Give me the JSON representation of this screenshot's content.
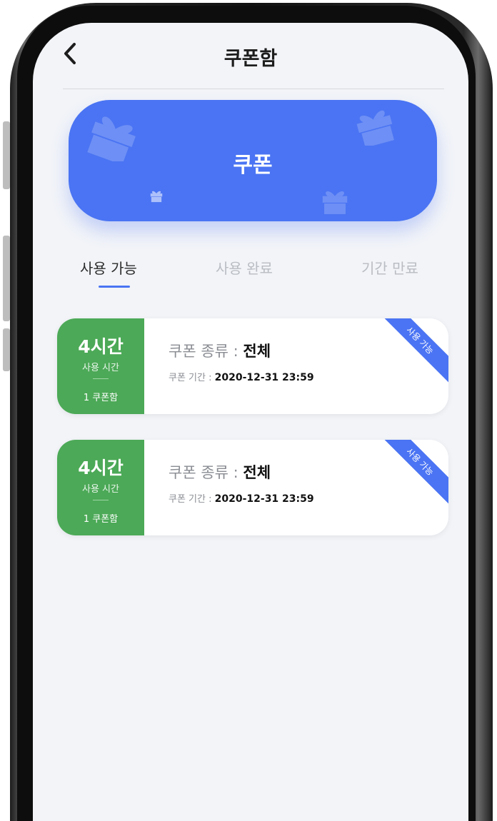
{
  "header": {
    "title": "쿠폰함"
  },
  "banner": {
    "title": "쿠폰"
  },
  "tabs": [
    {
      "label": "사용 가능",
      "active": true
    },
    {
      "label": "사용 완료",
      "active": false
    },
    {
      "label": "기간 만료",
      "active": false
    }
  ],
  "coupons": [
    {
      "hours": "4시간",
      "hours_label": "사용 시간",
      "count": "1 쿠폰함",
      "type_label": "쿠폰 종류 : ",
      "type_value": "전체",
      "period_label": "쿠폰 기간 : ",
      "period_value": "2020-12-31 23:59",
      "status": "사용 가능"
    },
    {
      "hours": "4시간",
      "hours_label": "사용 시간",
      "count": "1 쿠폰함",
      "type_label": "쿠폰 종류 : ",
      "type_value": "전체",
      "period_label": "쿠폰 기간 : ",
      "period_value": "2020-12-31 23:59",
      "status": "사용 가능"
    }
  ],
  "colors": {
    "accent": "#4a74f3",
    "coupon_green": "#4ca957",
    "screen_bg": "#f2f4f8"
  }
}
